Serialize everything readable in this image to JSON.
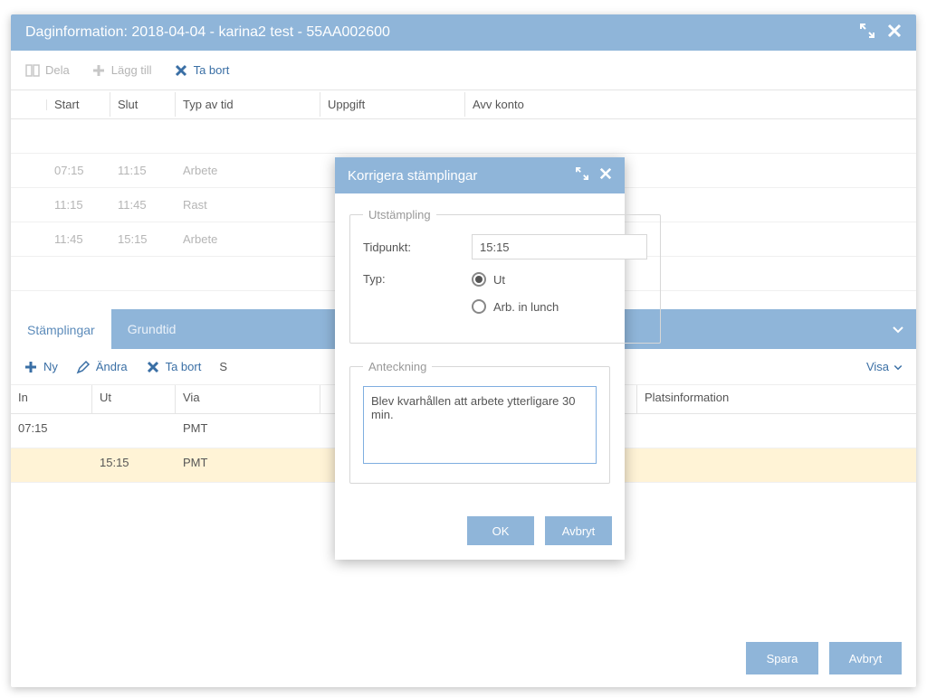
{
  "window": {
    "title": "Daginformation: 2018-04-04 - karina2 test - 55AA002600"
  },
  "toolbar1": {
    "dela": "Dela",
    "lagg_till": "Lägg till",
    "ta_bort": "Ta bort"
  },
  "grid1": {
    "headers": {
      "start": "Start",
      "slut": "Slut",
      "typ": "Typ av tid",
      "uppgift": "Uppgift",
      "avv": "Avv konto"
    },
    "rows": [
      {
        "start": "07:15",
        "slut": "11:15",
        "typ": "Arbete"
      },
      {
        "start": "11:15",
        "slut": "11:45",
        "typ": "Rast"
      },
      {
        "start": "11:45",
        "slut": "15:15",
        "typ": "Arbete"
      }
    ]
  },
  "tabs": {
    "stamplingar": "Stämplingar",
    "grundtid": "Grundtid"
  },
  "toolbar2": {
    "ny": "Ny",
    "andra": "Ändra",
    "ta_bort": "Ta bort",
    "s": "S",
    "visa": "Visa"
  },
  "grid2": {
    "headers": {
      "in": "In",
      "ut": "Ut",
      "via": "Via",
      "plats": "Platsinformation"
    },
    "rows": [
      {
        "in": "07:15",
        "ut": "",
        "via": "PMT"
      },
      {
        "in": "",
        "ut": "15:15",
        "via": "PMT",
        "highlight": true
      }
    ]
  },
  "footer": {
    "spara": "Spara",
    "avbryt": "Avbryt"
  },
  "modal": {
    "title": "Korrigera stämplingar",
    "utstampling_legend": "Utstämpling",
    "tidpunkt_label": "Tidpunkt:",
    "tidpunkt_value": "15:15",
    "typ_label": "Typ:",
    "typ_ut": "Ut",
    "typ_arb": "Arb. in lunch",
    "anteckning_legend": "Anteckning",
    "anteckning_text": "Blev kvarhållen att arbete ytterligare 30 min.",
    "ok": "OK",
    "avbryt": "Avbryt"
  }
}
